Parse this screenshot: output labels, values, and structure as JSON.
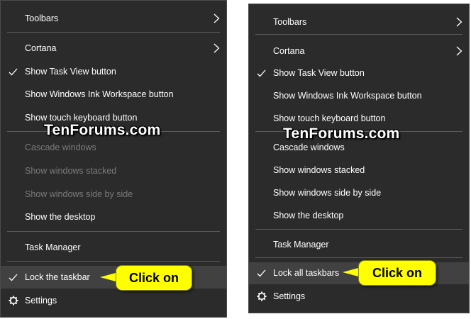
{
  "watermark": "TenForums.com",
  "callout_text": "Click on",
  "colors": {
    "menu_bg": "#2b2b2b",
    "callout_bg": "#ffff00",
    "disabled_text": "#7a7a7a",
    "highlight": "#414141"
  },
  "left_menu": {
    "toolbars": "Toolbars",
    "cortana": "Cortana",
    "show_task_view": "Show Task View button",
    "show_ink": "Show Windows Ink Workspace button",
    "show_touch_keyboard": "Show touch keyboard button",
    "cascade": "Cascade windows",
    "stacked": "Show windows stacked",
    "side_by_side": "Show windows side by side",
    "show_desktop": "Show the desktop",
    "task_manager": "Task Manager",
    "lock_taskbar": "Lock the taskbar",
    "settings": "Settings"
  },
  "right_menu": {
    "toolbars": "Toolbars",
    "cortana": "Cortana",
    "show_task_view": "Show Task View button",
    "show_ink": "Show Windows Ink Workspace button",
    "show_touch_keyboard": "Show touch keyboard button",
    "cascade": "Cascade windows",
    "stacked": "Show windows stacked",
    "side_by_side": "Show windows side by side",
    "show_desktop": "Show the desktop",
    "task_manager": "Task Manager",
    "lock_all_taskbars": "Lock all taskbars",
    "settings": "Settings"
  },
  "icons": {
    "check": "checkmark-icon",
    "submenu": "chevron-right-icon",
    "settings": "gear-icon"
  }
}
